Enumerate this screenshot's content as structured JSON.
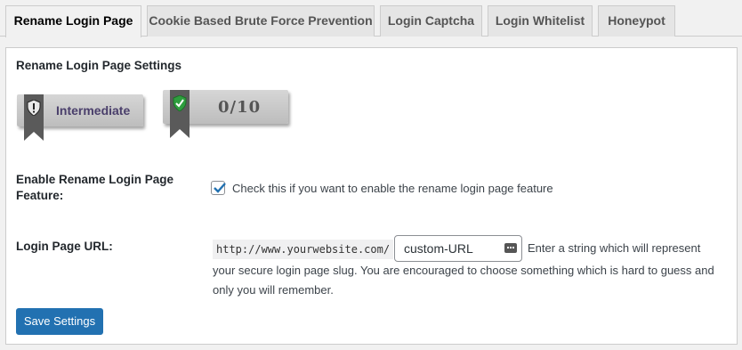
{
  "tabs": [
    {
      "label": "Rename Login Page",
      "active": true
    },
    {
      "label": "Cookie Based Brute Force Prevention",
      "active": false
    },
    {
      "label": "Login Captcha",
      "active": false
    },
    {
      "label": "Login Whitelist",
      "active": false
    },
    {
      "label": "Honeypot",
      "active": false
    }
  ],
  "panel": {
    "title": "Rename Login Page Settings",
    "level_badge": {
      "text": "Intermediate",
      "icon": "shield-exclamation-icon"
    },
    "score_badge": {
      "text": "0/10",
      "icon": "shield-check-icon",
      "icon_color": "#2e9e3e"
    },
    "enable": {
      "label": "Enable Rename Login Page Feature:",
      "checked": true,
      "description": "Check this if you want to enable the rename login page feature"
    },
    "url": {
      "label": "Login Page URL:",
      "prefix": "http://www.yourwebsite.com/",
      "value": "custom-URL",
      "description_inline": "Enter a string which will represent",
      "description_rest": "your secure login page slug. You are encouraged to choose something which is hard to guess and only you will remember."
    },
    "save_label": "Save Settings"
  },
  "colors": {
    "accent": "#2271b1",
    "badge_text": "#4a3f6b"
  }
}
